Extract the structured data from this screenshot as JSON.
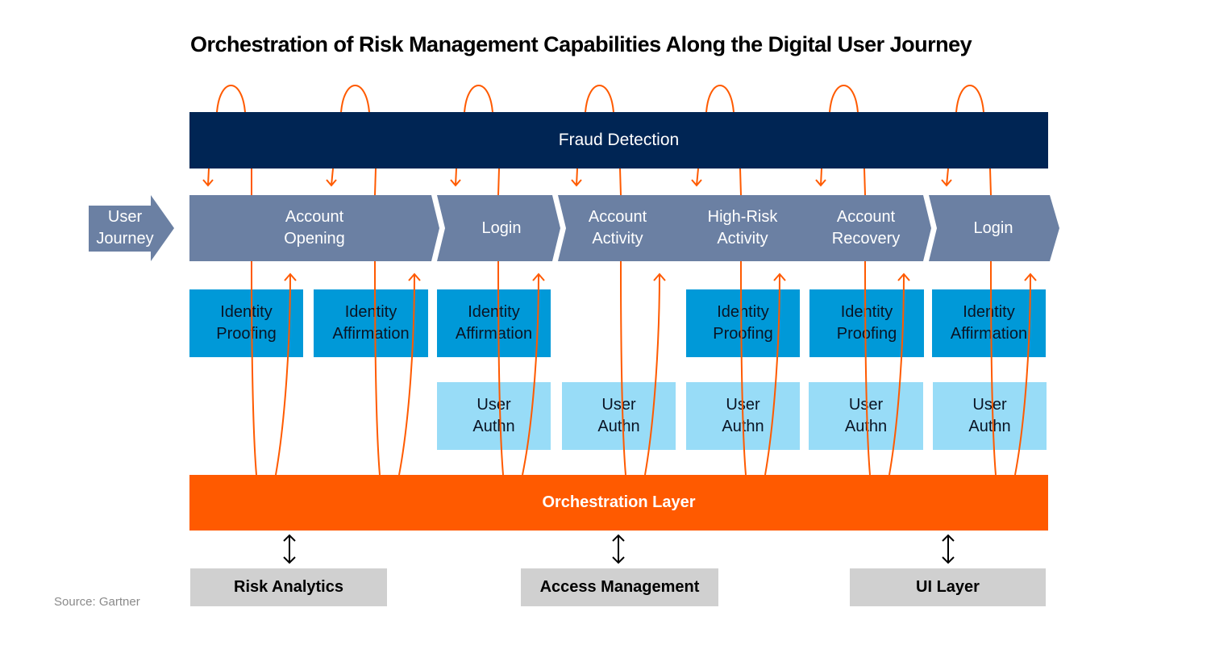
{
  "title": "Orchestration of Risk Management Capabilities Along the Digital User Journey",
  "fraud_detection": "Fraud Detection",
  "user_journey_label": "User\nJourney",
  "stages": [
    {
      "label": "Account\nOpening"
    },
    {
      "label": "Login"
    },
    {
      "label": "Account\nActivity"
    },
    {
      "label": "High-Risk\nActivity"
    },
    {
      "label": "Account\nRecovery"
    },
    {
      "label": "Login"
    }
  ],
  "identity_boxes": [
    {
      "label": "Identity\nProofing"
    },
    {
      "label": "Identity\nAffirmation"
    },
    {
      "label": "Identity\nAffirmation"
    },
    {
      "label": "Identity\nProofing"
    },
    {
      "label": "Identity\nProofing"
    },
    {
      "label": "Identity\nAffirmation"
    }
  ],
  "auth_boxes": [
    {
      "label": "User\nAuthn"
    },
    {
      "label": "User\nAuthn"
    },
    {
      "label": "User\nAuthn"
    },
    {
      "label": "User\nAuthn"
    },
    {
      "label": "User\nAuthn"
    }
  ],
  "orchestration_layer": "Orchestration Layer",
  "bottom_components": [
    {
      "label": "Risk Analytics"
    },
    {
      "label": "Access Management"
    },
    {
      "label": "UI Layer"
    }
  ],
  "source": "Source: Gartner",
  "colors": {
    "fraud_bar": "#002554",
    "journey": "#6b80a3",
    "identity": "#0099d8",
    "authn": "#98dcf7",
    "orchestration": "#ff5a00",
    "connector": "#ff5a00",
    "bottom_box": "#d0d0d0"
  }
}
